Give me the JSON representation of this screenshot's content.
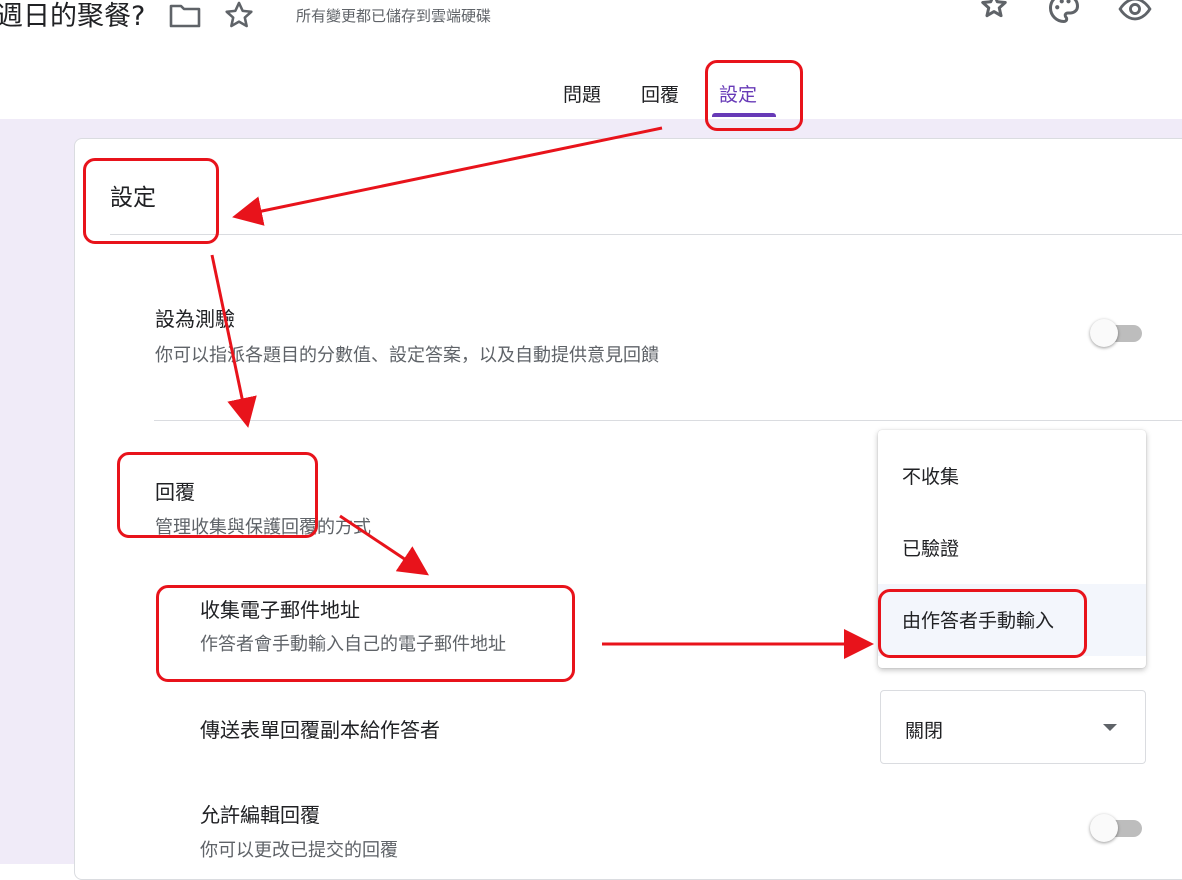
{
  "header": {
    "title": "週日的聚餐?",
    "save_status": "所有變更都已儲存到雲端硬碟",
    "icons": [
      "folder-icon",
      "star-icon",
      "addon-icon",
      "palette-icon",
      "preview-icon"
    ]
  },
  "tabs": [
    {
      "label": "問題"
    },
    {
      "label": "回覆"
    },
    {
      "label": "設定",
      "active": true
    }
  ],
  "settings": {
    "heading": "設定",
    "quiz": {
      "title": "設為測驗",
      "description": "你可以指派各題目的分數值、設定答案，以及自動提供意見回饋",
      "enabled": false
    },
    "responses": {
      "title": "回覆",
      "description": "管理收集與保護回覆的方式",
      "collect_email": {
        "title": "收集電子郵件地址",
        "description": "作答者會手動輸入自己的電子郵件地址",
        "options": [
          "不收集",
          "已驗證",
          "由作答者手動輸入"
        ],
        "selected": "由作答者手動輸入"
      },
      "send_copy": {
        "title": "傳送表單回覆副本給作答者",
        "value": "關閉"
      },
      "allow_edit": {
        "title": "允許編輯回覆",
        "description": "你可以更改已提交的回覆",
        "enabled": false
      }
    }
  },
  "colors": {
    "accent": "#673ab7",
    "annotation": "#e8131b",
    "page_bg": "#f0ebf8"
  }
}
